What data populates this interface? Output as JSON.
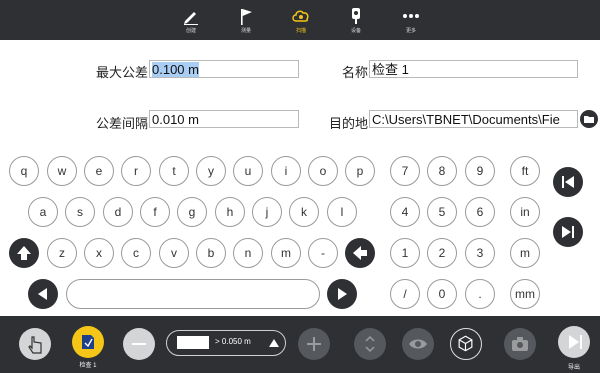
{
  "toolbar": {
    "tabs": [
      {
        "label": "创建",
        "icon": "pencil-icon"
      },
      {
        "label": "测量",
        "icon": "flag-icon"
      },
      {
        "label": "扫描",
        "icon": "scan-cloud-icon"
      },
      {
        "label": "设备",
        "icon": "instrument-icon"
      },
      {
        "label": "更多",
        "icon": "more-dots-icon"
      }
    ]
  },
  "form": {
    "max_tolerance_label": "最大公差",
    "max_tolerance_value": "0.100 m",
    "name_label": "名称",
    "name_value": "检查 1",
    "tolerance_interval_label": "公差间隔",
    "tolerance_interval_value": "0.010 m",
    "destination_label": "目的地",
    "destination_value": "C:\\Users\\TBNET\\Documents\\Fie"
  },
  "keyboard": {
    "row1": [
      "q",
      "w",
      "e",
      "r",
      "t",
      "y",
      "u",
      "i",
      "o",
      "p"
    ],
    "row2": [
      "a",
      "s",
      "d",
      "f",
      "g",
      "h",
      "j",
      "k",
      "l"
    ],
    "row3": [
      "z",
      "x",
      "c",
      "v",
      "b",
      "n",
      "m",
      "-"
    ],
    "numpad": [
      [
        "7",
        "8",
        "9",
        "ft"
      ],
      [
        "4",
        "5",
        "6",
        "in"
      ],
      [
        "1",
        "2",
        "3",
        "m"
      ],
      [
        "/",
        "0",
        ".",
        "mm"
      ]
    ]
  },
  "bottombar": {
    "item_label": "检查 1",
    "combo_text": "> 0.050 m",
    "export_label": "导出"
  },
  "colors": {
    "bar": "#2e3033",
    "accent": "#f5c518",
    "selection": "#a9cdf3"
  }
}
